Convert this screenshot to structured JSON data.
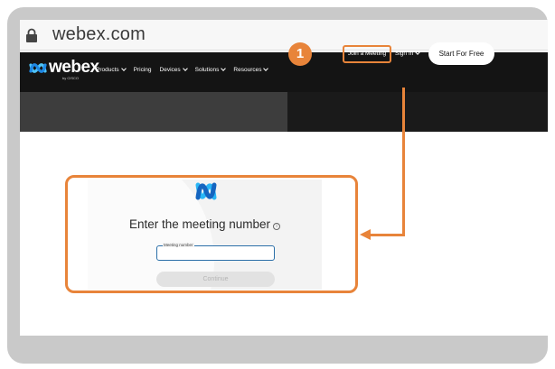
{
  "browser": {
    "url": "webex.com",
    "icon": "lock-icon"
  },
  "navbar": {
    "logo_text": "webex",
    "logo_sub": "by CISCO",
    "items": [
      {
        "label": "Products",
        "dropdown": true
      },
      {
        "label": "Pricing",
        "dropdown": false
      },
      {
        "label": "Devices",
        "dropdown": true
      },
      {
        "label": "Solutions",
        "dropdown": true
      },
      {
        "label": "Resources",
        "dropdown": true
      }
    ],
    "join_label": "Join a Meeting",
    "signin_label": "Sign In",
    "start_label": "Start For Free"
  },
  "annotation": {
    "step": "1",
    "color": "#e8843a"
  },
  "dialog": {
    "title": "Enter the meeting number",
    "field_label": "Meeting number",
    "field_value": "",
    "continue_label": "Continue"
  },
  "colors": {
    "accent": "#e8843a",
    "nav_bg": "#141414",
    "frame": "#c9c9c9"
  }
}
